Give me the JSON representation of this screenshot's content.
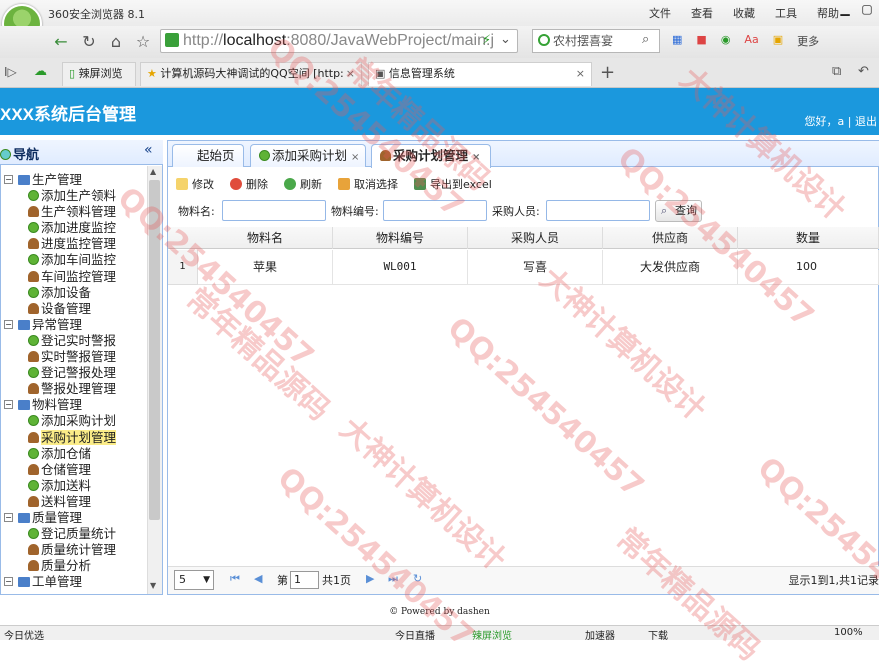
{
  "browser": {
    "name": "360安全浏览器 8.1",
    "menu": [
      "文件",
      "查看",
      "收藏",
      "工具",
      "帮助"
    ],
    "url_host": "http://",
    "url_main": "localhost",
    "url_rest": ":8080/JavaWebProject/main.j",
    "search_text": "农村摆喜宴",
    "more_label": "更多",
    "tabs": [
      {
        "label": "辣屏浏览"
      },
      {
        "label": "计算机源码大神调试的QQ空间 [http:"
      },
      {
        "label": "信息管理系统"
      }
    ]
  },
  "app": {
    "title": "XXX系统后台管理",
    "greeting": "您好，a | 退出"
  },
  "sidebar": {
    "title": "导航",
    "collapse_icon": "«",
    "tree": [
      {
        "type": "grp",
        "label": "生产管理"
      },
      {
        "type": "leaf",
        "icon": "add",
        "label": "添加生产领料"
      },
      {
        "type": "leaf",
        "icon": "user",
        "label": "生产领料管理"
      },
      {
        "type": "leaf",
        "icon": "add",
        "label": "添加进度监控"
      },
      {
        "type": "leaf",
        "icon": "user",
        "label": "进度监控管理"
      },
      {
        "type": "leaf",
        "icon": "add",
        "label": "添加车间监控"
      },
      {
        "type": "leaf",
        "icon": "user",
        "label": "车间监控管理"
      },
      {
        "type": "leaf",
        "icon": "add",
        "label": "添加设备"
      },
      {
        "type": "leaf",
        "icon": "user",
        "label": "设备管理"
      },
      {
        "type": "grp",
        "label": "异常管理"
      },
      {
        "type": "leaf",
        "icon": "add",
        "label": "登记实时警报"
      },
      {
        "type": "leaf",
        "icon": "user",
        "label": "实时警报管理"
      },
      {
        "type": "leaf",
        "icon": "add",
        "label": "登记警报处理"
      },
      {
        "type": "leaf",
        "icon": "user",
        "label": "警报处理管理"
      },
      {
        "type": "grp",
        "label": "物料管理"
      },
      {
        "type": "leaf",
        "icon": "add",
        "label": "添加采购计划"
      },
      {
        "type": "leaf",
        "icon": "user",
        "label": "采购计划管理",
        "selected": true
      },
      {
        "type": "leaf",
        "icon": "add",
        "label": "添加仓储"
      },
      {
        "type": "leaf",
        "icon": "user",
        "label": "仓储管理"
      },
      {
        "type": "leaf",
        "icon": "add",
        "label": "添加送料"
      },
      {
        "type": "leaf",
        "icon": "user",
        "label": "送料管理"
      },
      {
        "type": "grp",
        "label": "质量管理"
      },
      {
        "type": "leaf",
        "icon": "add",
        "label": "登记质量统计"
      },
      {
        "type": "leaf",
        "icon": "user",
        "label": "质量统计管理"
      },
      {
        "type": "leaf",
        "icon": "user",
        "label": "质量分析"
      },
      {
        "type": "grp",
        "label": "工单管理"
      }
    ]
  },
  "tabs": [
    {
      "label": "起始页"
    },
    {
      "label": "添加采购计划"
    },
    {
      "label": "采购计划管理"
    }
  ],
  "toolbar": {
    "edit": "修改",
    "delete": "删除",
    "refresh": "刷新",
    "deselect": "取消选择",
    "export": "导出到excel"
  },
  "filter": {
    "material_name_label": "物料名:",
    "material_no_label": "物料编号:",
    "buyer_label": "采购人员:",
    "query_label": "查询"
  },
  "grid": {
    "columns": [
      "物料名",
      "物料编号",
      "采购人员",
      "供应商",
      "数量"
    ],
    "rows": [
      {
        "num": "1",
        "cells": [
          "苹果",
          "WL001",
          "写喜",
          "大发供应商",
          "100"
        ]
      }
    ]
  },
  "pager": {
    "page_size": "5",
    "page_prefix": "第",
    "page_value": "1",
    "page_suffix": "共1页",
    "summary": "显示1到1,共1记录"
  },
  "footer": "© Powered by dashen",
  "statusbar": {
    "left": "今日优选",
    "items": [
      "今日直播",
      "辣屏浏览",
      "加速器",
      "下载",
      "100%"
    ]
  },
  "watermark": {
    "qq": "QQ:254540457",
    "a": "大神计算机设计",
    "b": "常年精品源码"
  }
}
